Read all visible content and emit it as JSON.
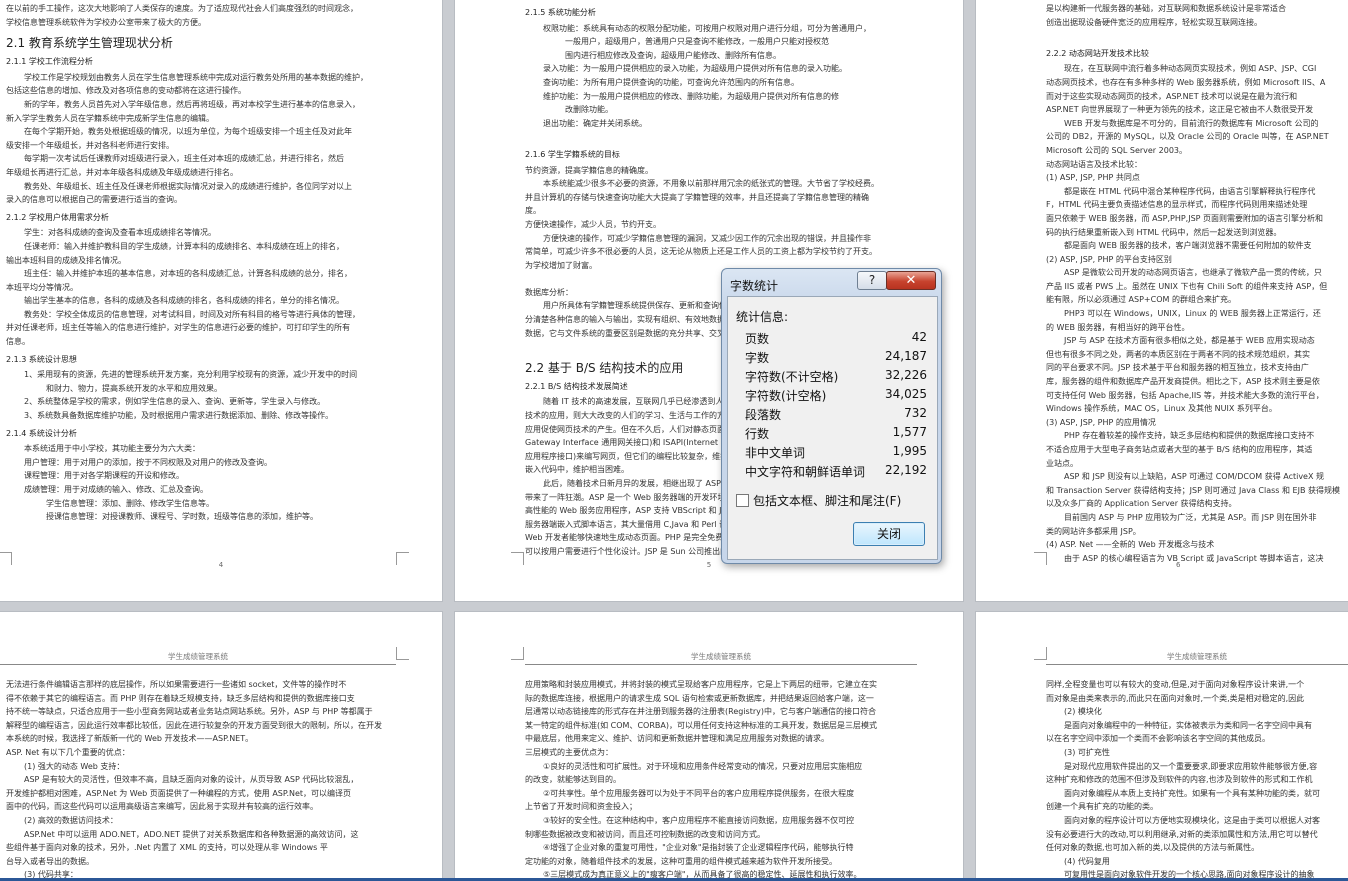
{
  "pages": {
    "p1": {
      "lines": [
        {
          "t": "在以前的手工操作，这次大地影响了人类保存的速度。为了适应现代社会人们高度强烈的时间观念，"
        },
        {
          "t": "学校信息管理系统软件为学校办公室带来了极大的方便。"
        },
        {
          "h": "2.1  教育系统学生管理现状分析"
        },
        {
          "s": "2.1.1  学校工作流程分析"
        },
        {
          "t": "学校工作是学校规划由教务人员在学生信息管理系统中完成对运行教务处所用的基本数据的维护，",
          "c": "ind"
        },
        {
          "t": "包括这些信息的增加、修改及对各项信息的变动都将在这进行操作。"
        },
        {
          "t": "新的学年，教务人员首先对入学年级信息，然后再将班级，再对本校学生进行基本的信息录入，",
          "c": "ind"
        },
        {
          "t": "新入学学生教务人员在学籍系统中完成新学生信息的编辑。"
        },
        {
          "t": "在每个学期开始，教务处根据班级的情况，以班为单位，为每个班级安排一个班主任及对此年",
          "c": "ind"
        },
        {
          "t": "级安排一个年级组长，并对各科老师进行安排。"
        },
        {
          "t": "每学期一次考试后任课教师对班级进行录入，班主任对本班的成绩汇总，并进行排名，然后",
          "c": "ind"
        },
        {
          "t": "年级组长再进行汇总，并对本年级各科成绩及年级成绩进行排名。"
        },
        {
          "t": "教务处、年级组长、班主任及任课老师根据实际情况对录入的成绩进行维护，各位同学对以上",
          "c": "ind"
        },
        {
          "t": "录入的信息可以根据自己的需要进行适当的查询。"
        },
        {
          "s": "2.1.2  学校用户体用需求分析"
        },
        {
          "t": "学生：对各科成绩的查询及查看本班成绩排名等情况。",
          "c": "ind"
        },
        {
          "t": "任课老师：输入并维护教科目的学生成绩，计算本科的成绩排名、本科成绩在班上的排名，",
          "c": "ind"
        },
        {
          "t": "输出本班科目的成绩及排名情况。"
        },
        {
          "t": "班主任：输入并维护本班的基本信息，对本班的各科成绩汇总，计算各科成绩的总分，排名，",
          "c": "ind"
        },
        {
          "t": "本班平均分等情况。"
        },
        {
          "t": "输出学生基本的信息，各科的成绩及各科成绩的排名，各科成绩的排名，单分的排名情况。",
          "c": "ind"
        },
        {
          "t": "教务处：学校全体成员的信息管理，对考试科目，时间及对所有科目的格号等进行具体的管理，",
          "c": "ind"
        },
        {
          "t": "并对任课老师，班主任等输入的信息进行维护，对学生的信息进行必要的维护，可打印学生的所有"
        },
        {
          "t": "信息。"
        },
        {
          "s": "2.1.3  系统设计思想"
        },
        {
          "t": "1、采用现有的资源，先进的管理系统开发方案，充分利用学校现有的资源，减少开发中的时间",
          "c": "ind"
        },
        {
          "t": "和财力、物力，提高系统开发的水平和应用效果。",
          "c": "sub"
        },
        {
          "t": "2、系统整体是学校的需求，例如学生信息的录入、查询、更新等，学生录入与修改。",
          "c": "ind"
        },
        {
          "t": "3、系统数具备数据库维护功能，及时根据用户需求进行数据添加、删除、修改等操作。",
          "c": "ind"
        },
        {
          "s": "2.1.4  系统设计分析"
        },
        {
          "t": "本系统适用于中小学校，其功能主要分为六大类：",
          "c": "ind"
        },
        {
          "t": "用户管理：用于对用户的添加，按于不同权限及对用户的修改及查询。",
          "c": "ind"
        },
        {
          "t": "课程管理：用于对各学期课程的开设和修改。",
          "c": "ind"
        },
        {
          "t": "成绩管理：用于对成绩的输入、修改、汇总及查询。",
          "c": "ind"
        },
        {
          "t": "学生信息管理：添加、删除、修改学生信息等。",
          "c": "sub"
        },
        {
          "t": "授课信息管理：对授课教师、课程号、学时数，班级等信息的添加，维护等。",
          "c": "sub"
        }
      ],
      "number": "4"
    },
    "p2": {
      "lines": [
        {
          "s": "2.1.5  系统功能分析"
        },
        {
          "t": "权限功能：系统具有动态的权限分配功能，可按用户权限对用户进行分组，可分为普通用户，",
          "c": "ind"
        },
        {
          "t": "一般用户，超级用户，普通用户只是查询不能修改，一般用户只能对授权范",
          "c": "sub"
        },
        {
          "t": "围内进行相应修改及查询，超级用户能修改、删除所有信息。",
          "c": "sub"
        },
        {
          "t": "录入功能：为一般用户提供相应的录入功能，为超级用户提供对所有信息的录入功能。",
          "c": "ind"
        },
        {
          "t": "查询功能：为所有用户提供查询的功能，可查询允许范围内的所有信息。",
          "c": "ind"
        },
        {
          "t": "维护功能：为一般用户提供相应的修改、删除功能，为超级用户提供对所有信息的修",
          "c": "ind"
        },
        {
          "t": "改删除功能。",
          "c": "sub"
        },
        {
          "t": "退出功能：确定并关闭系统。",
          "c": "ind"
        },
        {
          "t": ""
        },
        {
          "s": "2.1.6  学生学籍系统的目标"
        },
        {
          "t": "节约资源，提高学籍信息的精确度。"
        },
        {
          "t": "本系统能减少很多不必要的资源，不用象以前那样用冗余的纸张式的管理。大节省了学校经费。",
          "c": "ind"
        },
        {
          "t": "并且计算机的存储与快速查询功能大大提高了学籍管理的效率，并且还提高了学籍信息管理的精确"
        },
        {
          "t": "度。"
        },
        {
          "t": "方便快速操作，减少人员，节约开支。"
        },
        {
          "t": "方便快速的操作，可减少学籍信息管理的漏洞，又减少因工作的冗余出现的错误，并且操作非",
          "c": "ind"
        },
        {
          "t": "常简单，可减少许多不很必要的人员，这无论从物质上还是工作人员的工资上都为学校节约了开支。"
        },
        {
          "t": "为学校增加了财富。"
        },
        {
          "t": ""
        },
        {
          "t": "数据库分析："
        },
        {
          "t": "用户所具体有学籍管理系统提供保存、更新和查询信息的能力。",
          "c": "ind"
        },
        {
          "t": "分清楚各种信息的输入与输出，实现有组织、有效地数据库的管理，"
        },
        {
          "t": "数据，它与文件系统的重要区别是数据的充分共享、交叉访问，"
        },
        {
          "t": ""
        },
        {
          "h": "2.2   基于 B/S 结构技术的应用"
        },
        {
          "s": "2.2.1   B/S 结构技术发展简述"
        },
        {
          "t": "随着 IT 技术的高速发展，互联网几乎已经渗透到人类生活的各个",
          "c": "ind"
        },
        {
          "t": "技术的应用，则大大改变的人们的学习、生活与工作的方式，HTML"
        },
        {
          "t": "应用促使网页技术的产生。但在不久后，人们对静态页面已无法满足，"
        },
        {
          "t": "Gateway Interface 通用网关接口)和 ISAPI(Internet Server Application"
        },
        {
          "t": "应用程序接口)来编写网页，但它们的编程比较复杂，维护也较"
        },
        {
          "t": "嵌入代码中，维护相当困难。"
        },
        {
          "t": "此后，随着技术日新月异的发展，相继出现了 ASP、PHP、JSP",
          "c": "ind"
        },
        {
          "t": "带来了一阵狂潮。ASP 是一个 Web 服务器端的开发环境，利用它可以"
        },
        {
          "t": "高性能的 Web 服务应用程序，ASP 支持 VBScript 和 JavaScript 等脚本"
        },
        {
          "t": "服务器端嵌入式脚本语言，其大量借用 C,Java 和 Perl 语言的语法，"
        },
        {
          "t": "Web 开发者能够快速地生成动态页面。PHP 是完全免费的，不用"
        },
        {
          "t": "可以按用户需要进行个性化设计。JSP 是 Sun 公司推出的新一代"
        }
      ],
      "number": "5"
    },
    "p3": {
      "lines": [
        {
          "t": "是以构建新一代服务器的基础，对互联网和数据系统设计是非常适合"
        },
        {
          "t": "创造出据现设备硬件宽泛的应用程序，轻松实现互联网连接。"
        },
        {
          "t": ""
        },
        {
          "s": "2.2.2  动态网站开发技术比较"
        },
        {
          "t": "现在，在互联网中流行着多种动态网页实现技术，例如 ASP、JSP、CGI",
          "c": "ind"
        },
        {
          "t": "动态网页技术，也存在有多种多样的 Web 服务器系统，例如 Microsoft IIS、A"
        },
        {
          "t": "而对于这些实现动态网页的技术，ASP.NET 技术可以说是在最为流行和"
        },
        {
          "t": "ASP.NET 向世界展现了一种更为领先的技术，这正是它被由不人数很受开发"
        },
        {
          "t": "WEB 开发与数据库是不可分的，目前流行的数据库有 Microsoft 公司的",
          "c": "ind"
        },
        {
          "t": "公司的 DB2，开源的 MySQL，以及 Oracle 公司的 Oracle 叫等，在 ASP.NET"
        },
        {
          "t": "Microsoft 公司的 SQL Server 2003。"
        },
        {
          "t": "动态网站语言及技术比较："
        },
        {
          "t": "(1) ASP, JSP, PHP 共同点"
        },
        {
          "t": "都是嵌在 HTML 代码中混合某种程序代码，由语言引擎解释执行程序代",
          "c": "ind"
        },
        {
          "t": "F，HTML 代码主要负责描述信息的显示样式，而程序代码则用来描述处理"
        },
        {
          "t": "面只依赖于 WEB 服务器，而 ASP,PHP,JSP 页面则需要附加的语言引擎分析和"
        },
        {
          "t": "码的执行结果重新嵌入到 HTML 代码中，然后一起发送到浏览器。"
        },
        {
          "t": "都是面向 WEB 服务器的技术，客户端浏览器不需要任何附加的软件支",
          "c": "ind"
        },
        {
          "t": "(2) ASP, JSP, PHP 的平台支持区别"
        },
        {
          "t": "ASP 是微软公司开发的动态网页语言，也继承了微软产品一贯的传统，只",
          "c": "ind"
        },
        {
          "t": "产品 IIS 或者 PWS 上。虽然在 UNIX 下也有 Chili Soft 的组件来支持 ASP，但"
        },
        {
          "t": "能有限，所以必须通过 ASP+COM 的群组合来扩充。"
        },
        {
          "t": "PHP3 可以在 Windows，UNIX，Linux 的 WEB 服务器上正常运行，还",
          "c": "ind"
        },
        {
          "t": "的 WEB 服务器，有相当好的跨平台性。"
        },
        {
          "t": "JSP 与 ASP 在技术方面有很多相似之处，都是基于 WEB 应用实现动态",
          "c": "ind"
        },
        {
          "t": "但也有很多不同之处，两者的本质区别在于两者不同的技术规范组织，其实"
        },
        {
          "t": "同的平台要求不同。JSP 技术基于平台和服务器的相互独立，技术支持由广"
        },
        {
          "t": "库，服务器的组件和数据库产品开发商提供。相比之下，ASP 技术则主要是依"
        },
        {
          "t": "可支持任何 Web 服务器，包括 Apache,IIS 等，并技术能大多数的流行平台，"
        },
        {
          "t": "Windows 操作系统，MAC OS，Linux 及其他 NUIX 系列平台。"
        },
        {
          "t": "(3) ASP, JSP, PHP 的应用情况"
        },
        {
          "t": "PHP 存在着较差的操作支持，缺乏多层结构和提供的数据库接口支持不",
          "c": "ind"
        },
        {
          "t": "不适合应用于大型电子商务站点或者大型的基于 B/S 结构的应用程序，其适"
        },
        {
          "t": "业站点。"
        },
        {
          "t": "ASP 和 JSP 则没有以上缺陷，ASP 可通过 COM/DCOM 获得 ActiveX 规",
          "c": "ind"
        },
        {
          "t": "和 Transaction Server 获得结构支持；JSP 则可通过 Java Class 和 EJB 获得规模"
        },
        {
          "t": "以及众多厂商的 Application Server 获得结构支持。"
        },
        {
          "t": "目前国内 ASP 与 PHP 应用较为广泛，尤其是 ASP。而 JSP 则在国外非",
          "c": "ind"
        },
        {
          "t": "类的网站许多都采用 JSP。"
        },
        {
          "t": "(4)  ASP. Net  ——全新的 Web 开发概念与技术"
        },
        {
          "t": "由于 ASP 的核心编程语言为 VB Script 或 JavaScript 等脚本语言，这决",
          "c": "ind"
        }
      ],
      "number": "6"
    },
    "p4": {
      "header": "学生成绩管理系统",
      "lines": [
        {
          "t": "无法进行条件编辑语言那样的底层操作，所以如果需要进行一些诸如 socket，文件等的操作时不"
        },
        {
          "t": "得不依赖于其它的编程语言。而 PHP 则存在着缺乏规模支持，缺乏多层结构和提供的数据库接口支"
        },
        {
          "t": "持不统一等缺点，只适合应用于一些小型商务网站或者业务站点网站系统。另外，ASP 与 PHP 等都属于"
        },
        {
          "t": "解释型的编程语言，因此运行效率都比较低，因此在进行较复杂的开发方面受到很大的限制，所以，在开发"
        },
        {
          "t": "本系统的时候，我选择了新版新一代的 Web 开发技术——ASP.NET。"
        },
        {
          "t": "ASP. Net 有以下几个重要的优点："
        },
        {
          "t": "(1)  强大的动态 Web 支持：",
          "c": "ind"
        },
        {
          "t": "ASP 是有较大的灵活性，但效率不高，且缺乏面向对象的设计，从页导致 ASP 代码比较混乱，",
          "c": "ind"
        },
        {
          "t": "开发维护都相对困难，ASP.Net 为 Web 页面提供了一种编程的方式，使用 ASP.Net，可以编译页"
        },
        {
          "t": "面中的代码，而这些代码可以运用高级语言来编写，因此易于实现并有较高的运行效率。"
        },
        {
          "t": "(2)  高效的数据访问技术：",
          "c": "ind"
        },
        {
          "t": "ASP.Net 中可以运用 ADO.NET，ADO.NET 提供了对关系数据库和各种数据源的高效访问，这",
          "c": "ind"
        },
        {
          "t": "些组件基于面向对象的技术，另外，.Net 内置了 XML 的支持，可以处理从非 Windows 平"
        },
        {
          "t": "台导入或者导出的数据。"
        },
        {
          "t": "(3)  代码共享：",
          "c": "ind"
        }
      ]
    },
    "p5": {
      "header": "学生成绩管理系统",
      "lines": [
        {
          "t": "应用策略和封装应用模式，并将封装的模式呈现给客户应用程序，它是上下两层的纽带，它建立在实"
        },
        {
          "t": "际的数据库连接，根据用户的请求生成 SQL 语句检索或更新数据库，并把结果返回给客户端，这一"
        },
        {
          "t": "层通常以动态链接库的形式存在并注册到服务器的注册表(Registry)中，它与客户端通信的接口符合"
        },
        {
          "t": "某一特定的组件标准(如 COM、CORBA)，可以用任何支持这种标准的工具开发，数据层是三层模式"
        },
        {
          "t": "中最底层，他用来定义、维护、访问和更新数据并管理和满足应用服务对数据的请求。"
        },
        {
          "t": "三层模式的主要优点为："
        },
        {
          "t": "①良好的灵活性和可扩展性。对于环境和应用条件经常变动的情况，只要对应用层实施相应",
          "c": "ind"
        },
        {
          "t": "的改变，就能够达到目的。"
        },
        {
          "t": "②可共享性。单个应用服务器可以为处于不同平台的客户应用程序提供服务，在很大程度",
          "c": "ind"
        },
        {
          "t": "上节省了开发时间和资金投入；"
        },
        {
          "t": "③较好的安全性。在这种结构中，客户应用程序不能直接访问数据，应用服务器不仅可控",
          "c": "ind"
        },
        {
          "t": "制哪些数据被改变和被访问，而且还可控制数据的改变和访问方式。"
        },
        {
          "t": "④增强了企业对象的重复可用性，\"企业对象\"是指封装了企业逻辑程序代码，能够执行特",
          "c": "ind"
        },
        {
          "t": "定功能的对象，随着组件技术的发展，这种可重用的组件模式越来越为软件开发所接受。"
        },
        {
          "t": "⑤三层模式成为真正意义上的\"瘦客户端\"，从而具备了很高的稳定性、延展性和执行效率。",
          "c": "ind"
        }
      ]
    },
    "p6": {
      "header": "学生成绩管理系统",
      "lines": [
        {
          "t": "同样,全程变量也可以有较大的变动,但是,对于面向对象程序设计来讲,一个"
        },
        {
          "t": "而对象是由类来表示的,而此只在面向对象时,一个类,类是相对稳定的,因此"
        },
        {
          "t": "(2)  模块化",
          "c": "ind"
        },
        {
          "t": "是面向对象编程中的一种特征，实体被表示为类和同一名字空间中具有",
          "c": "ind"
        },
        {
          "t": "以在名字空间中添加一个类而不会影响该名字空间的其他成员。"
        },
        {
          "t": "(3)  可扩充性",
          "c": "ind"
        },
        {
          "t": "是对现代应用软件提出的又一个重要要求,即要求应用软件能够很方便,容",
          "c": "ind"
        },
        {
          "t": "这种扩充和修改的范围不但涉及到软件的内容,也涉及到软件的形式和工作机"
        },
        {
          "t": "面向对象编程从本质上支持扩充性。如果有一个具有某种功能的类，就可",
          "c": "ind"
        },
        {
          "t": "创建一个具有扩充的功能的类。"
        },
        {
          "t": "面向对象的程序设计可以方便地实现模块化，这是由于类可以根据人对客",
          "c": "ind"
        },
        {
          "t": "没有必要进行大的改动,可以利用继承,对新的类添加属性和方法,用它可以替代"
        },
        {
          "t": "任何对象的数据,也可加入新的类,以及提供的方法与新属性。"
        },
        {
          "t": "(4)  代码复用",
          "c": "ind"
        },
        {
          "t": "可复用性是面向对象软件开发的一个核心思路,面向对象程序设计的抽象",
          "c": "ind"
        }
      ]
    }
  },
  "dialog": {
    "title": "字数统计",
    "help_icon": "?",
    "close_icon": "✕",
    "section_label": "统计信息:",
    "stats": [
      {
        "label": "页数",
        "value": "42"
      },
      {
        "label": "字数",
        "value": "24,187"
      },
      {
        "label": "字符数(不计空格)",
        "value": "32,226"
      },
      {
        "label": "字符数(计空格)",
        "value": "34,025"
      },
      {
        "label": "段落数",
        "value": "732"
      },
      {
        "label": "行数",
        "value": "1,577"
      },
      {
        "label": "非中文单词",
        "value": "1,995"
      },
      {
        "label": "中文字符和朝鲜语单词",
        "value": "22,192"
      }
    ],
    "checkbox_label": "包括文本框、脚注和尾注(F)",
    "checkbox_checked": false,
    "close_button_label": "关闭"
  }
}
